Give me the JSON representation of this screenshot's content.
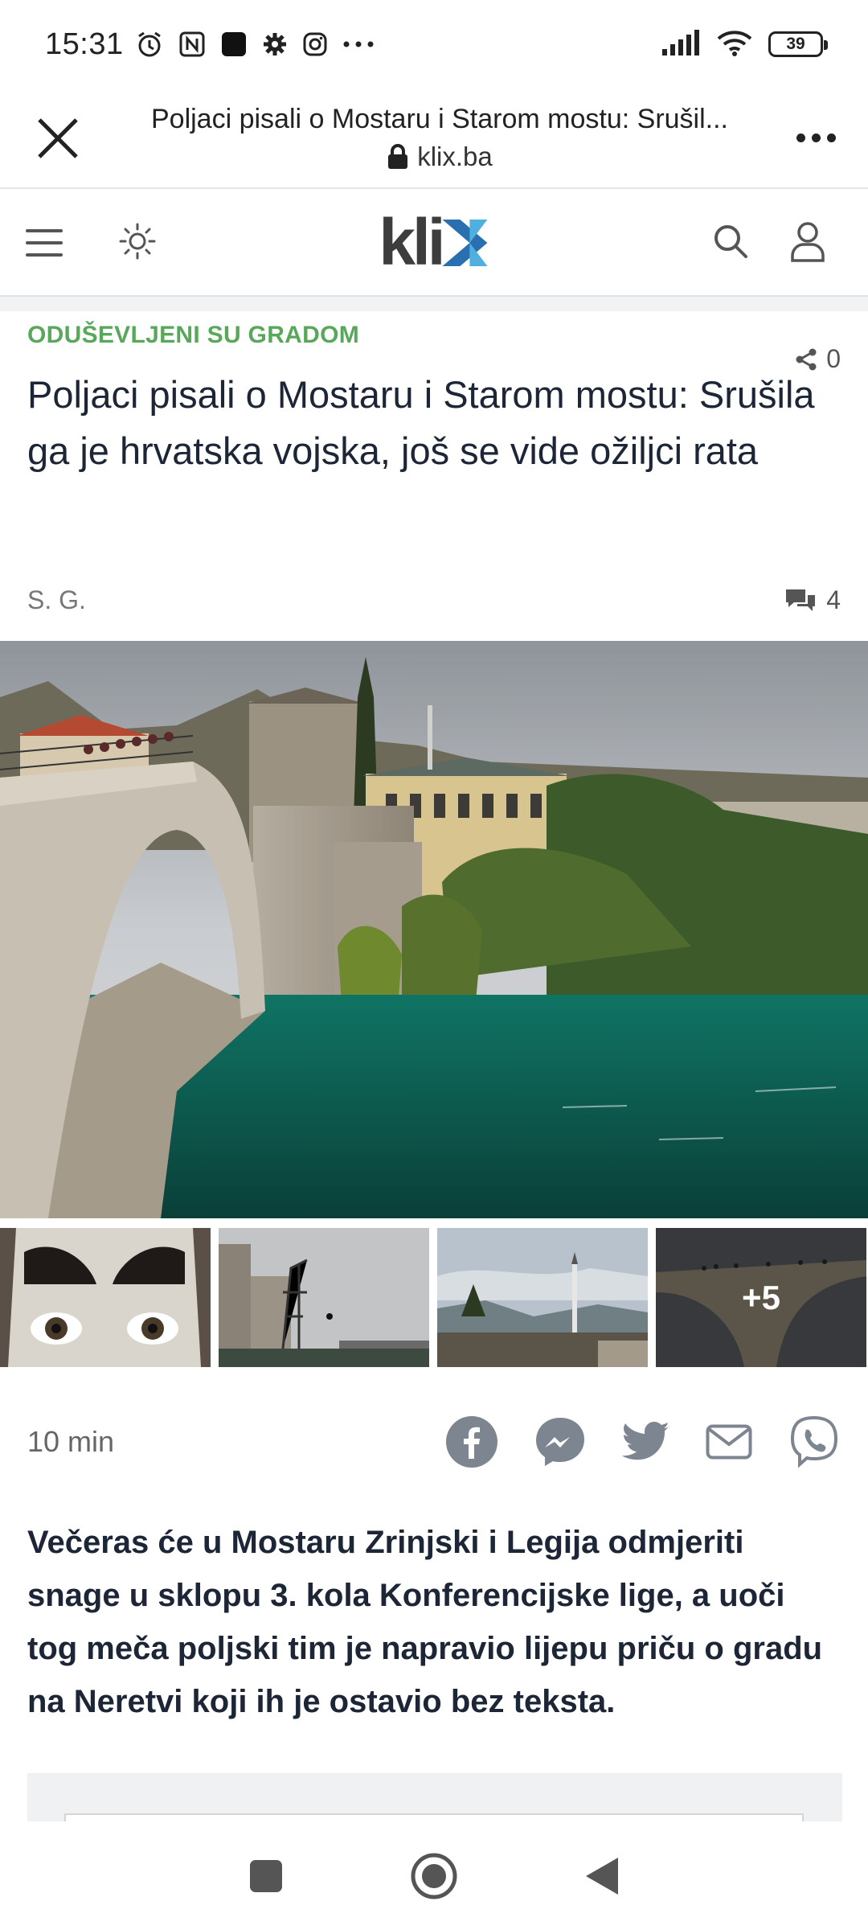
{
  "status_bar": {
    "time": "15:31",
    "battery": "39",
    "icons": [
      "alarm-icon",
      "nfc-icon",
      "app-square-icon",
      "gear-icon",
      "instagram-icon",
      "more-dots-icon",
      "signal-icon",
      "wifi-icon",
      "battery-icon"
    ]
  },
  "browser": {
    "title": "Poljaci pisali o Mostaru i Starom mostu: Srušil...",
    "url": "klix.ba"
  },
  "site": {
    "logo": "klix"
  },
  "article": {
    "kicker": "ODUŠEVLJENI SU GRADOM",
    "share_count": "0",
    "headline": "Poljaci pisali o Mostaru i Starom mostu: Srušila ga je hrvatska vojska, još se vide ožiljci rata",
    "author": "S. G.",
    "comment_count": "4",
    "gallery_more": "+5",
    "read_time": "10 min",
    "lead": "Večeras će u Mostaru Zrinjski i Legija odmjeriti snage u sklopu 3. kola Konferencijske lige, a uoči tog meča poljski tim je napravio lijepu priču o gradu na Neretvi koji ih je ostavio bez teksta."
  },
  "colors": {
    "kicker": "#58a75a",
    "logo_x_dark": "#2a6fb0",
    "logo_x_light": "#4fb0e0",
    "headline": "#1d2637"
  }
}
